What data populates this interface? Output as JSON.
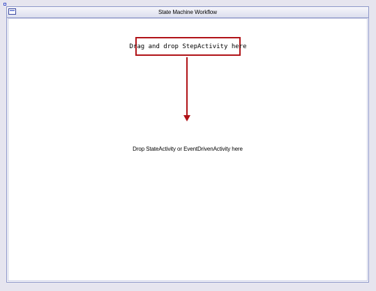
{
  "workflow": {
    "title": "State Machine Workflow",
    "drop_hint": "Drop StateActivity or EventDrivenActivity here"
  },
  "callout": {
    "text": "Drag and drop StepActivity here"
  },
  "icons": {
    "header_icon": "state-icon",
    "selection_handle": "selection-handle-icon"
  },
  "colors": {
    "callout_border": "#b01217",
    "arrow": "#b01217",
    "designer_border": "#8d97c9",
    "background": "#e6e5ef"
  }
}
